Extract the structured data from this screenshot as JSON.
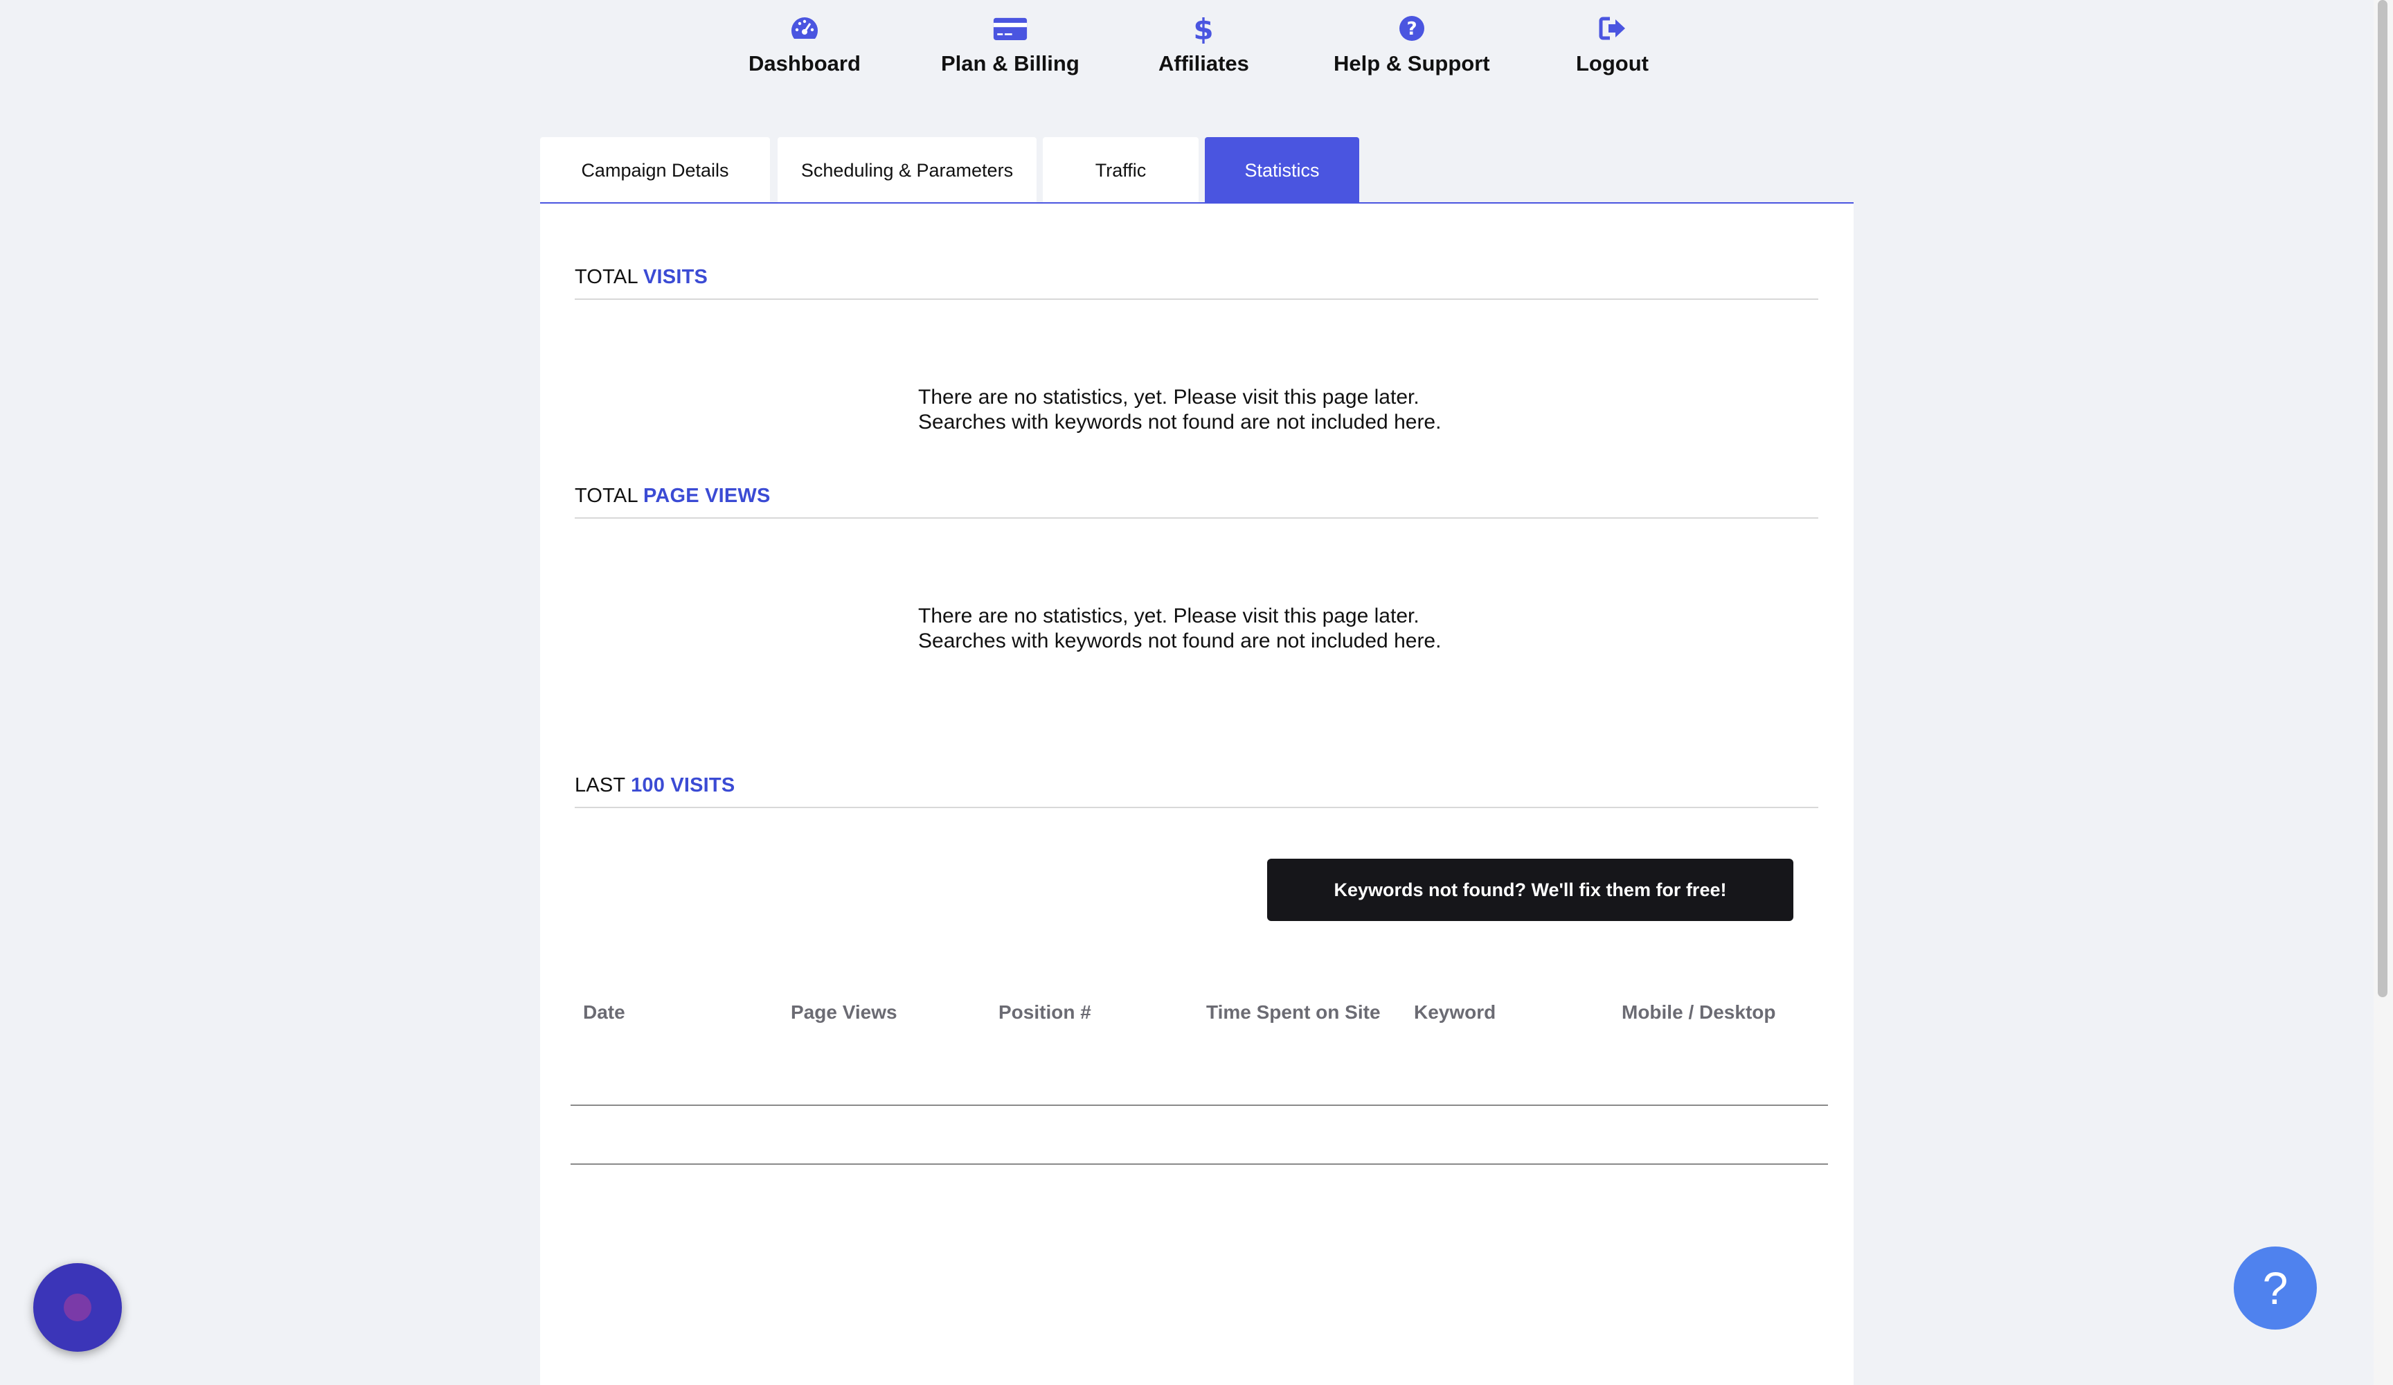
{
  "nav": {
    "items": [
      {
        "label": "Dashboard",
        "icon": "gauge-icon"
      },
      {
        "label": "Plan & Billing",
        "icon": "credit-card-icon"
      },
      {
        "label": "Affiliates",
        "icon": "dollar-icon"
      },
      {
        "label": "Help & Support",
        "icon": "question-circle-icon"
      },
      {
        "label": "Logout",
        "icon": "logout-icon"
      }
    ],
    "icon_color": "#4a55e0"
  },
  "tabs": [
    {
      "label": "Campaign Details",
      "active": false
    },
    {
      "label": "Scheduling & Parameters",
      "active": false
    },
    {
      "label": "Traffic",
      "active": false
    },
    {
      "label": "Statistics",
      "active": true
    }
  ],
  "sections": {
    "total_visits": {
      "prefix": "TOTAL",
      "accent": "VISITS"
    },
    "total_page_views": {
      "prefix": "TOTAL",
      "accent": "PAGE VIEWS"
    },
    "last_visits": {
      "prefix": "LAST",
      "accent": "100 VISITS"
    }
  },
  "empty_message": {
    "line1": "There are no statistics, yet. Please visit this page later.",
    "line2": "Searches with keywords not found are not included here."
  },
  "cta_label": "Keywords not found? We'll fix them for free!",
  "table": {
    "columns": [
      "Date",
      "Page Views",
      "Position #",
      "Time Spent on Site",
      "Keyword",
      "Mobile / Desktop"
    ]
  },
  "help_fab": "?",
  "colors": {
    "accent": "#4a55e0",
    "background": "#f0f2f6"
  }
}
